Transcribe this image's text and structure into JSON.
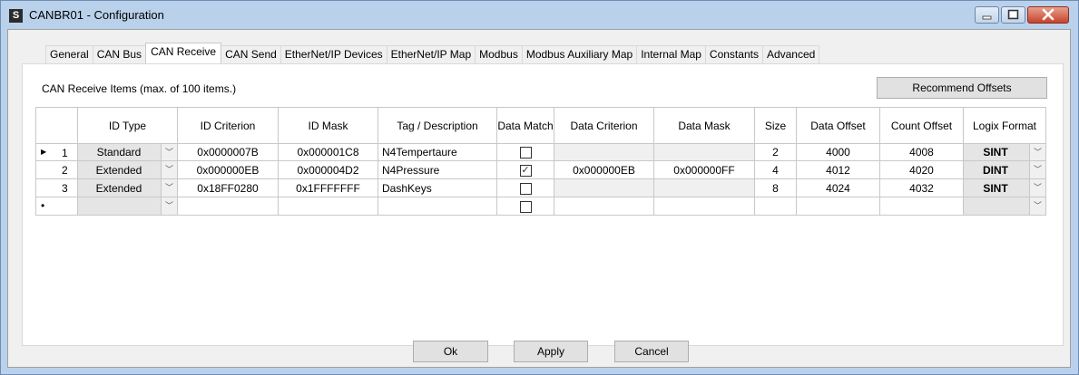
{
  "window": {
    "title": "CANBR01 - Configuration",
    "app_icon_glyph": "S"
  },
  "tabs": [
    "General",
    "CAN Bus",
    "CAN Receive",
    "CAN Send",
    "EtherNet/IP Devices",
    "EtherNet/IP Map",
    "Modbus",
    "Modbus Auxiliary Map",
    "Internal Map",
    "Constants",
    "Advanced"
  ],
  "active_tab": "CAN Receive",
  "panel": {
    "items_label": "CAN Receive Items (max. of 100 items.)",
    "recommend_button": "Recommend Offsets"
  },
  "table": {
    "headers": [
      "ID Type",
      "ID Criterion",
      "ID Mask",
      "Tag / Description",
      "Data Match",
      "Data Criterion",
      "Data Mask",
      "Size",
      "Data Offset",
      "Count Offset",
      "Logix Format"
    ],
    "rows": [
      {
        "marker": "▶",
        "num": "1",
        "id_type": "Standard",
        "id_criterion": "0x0000007B",
        "id_mask": "0x000001C8",
        "tag": "N4Tempertaure",
        "data_match": false,
        "data_criterion": "",
        "data_mask": "",
        "size": "2",
        "data_offset": "4000",
        "count_offset": "4008",
        "logix_format": "SINT"
      },
      {
        "marker": "",
        "num": "2",
        "id_type": "Extended",
        "id_criterion": "0x000000EB",
        "id_mask": "0x000004D2",
        "tag": "N4Pressure",
        "data_match": true,
        "data_criterion": "0x000000EB",
        "data_mask": "0x000000FF",
        "size": "4",
        "data_offset": "4012",
        "count_offset": "4020",
        "logix_format": "DINT"
      },
      {
        "marker": "",
        "num": "3",
        "id_type": "Extended",
        "id_criterion": "0x18FF0280",
        "id_mask": "0x1FFFFFFF",
        "tag": "DashKeys",
        "data_match": false,
        "data_criterion": "",
        "data_mask": "",
        "size": "8",
        "data_offset": "4024",
        "count_offset": "4032",
        "logix_format": "SINT"
      },
      {
        "marker": "•",
        "num": "",
        "id_type": "",
        "id_criterion": "",
        "id_mask": "",
        "tag": "",
        "data_match": false,
        "data_criterion": "",
        "data_mask": "",
        "size": "",
        "data_offset": "",
        "count_offset": "",
        "logix_format": ""
      }
    ]
  },
  "buttons": {
    "ok": "Ok",
    "apply": "Apply",
    "cancel": "Cancel"
  },
  "colors": {
    "titlebar": "#b9d1ea",
    "client": "#f0f0f0",
    "close_button": "#c7432a"
  }
}
